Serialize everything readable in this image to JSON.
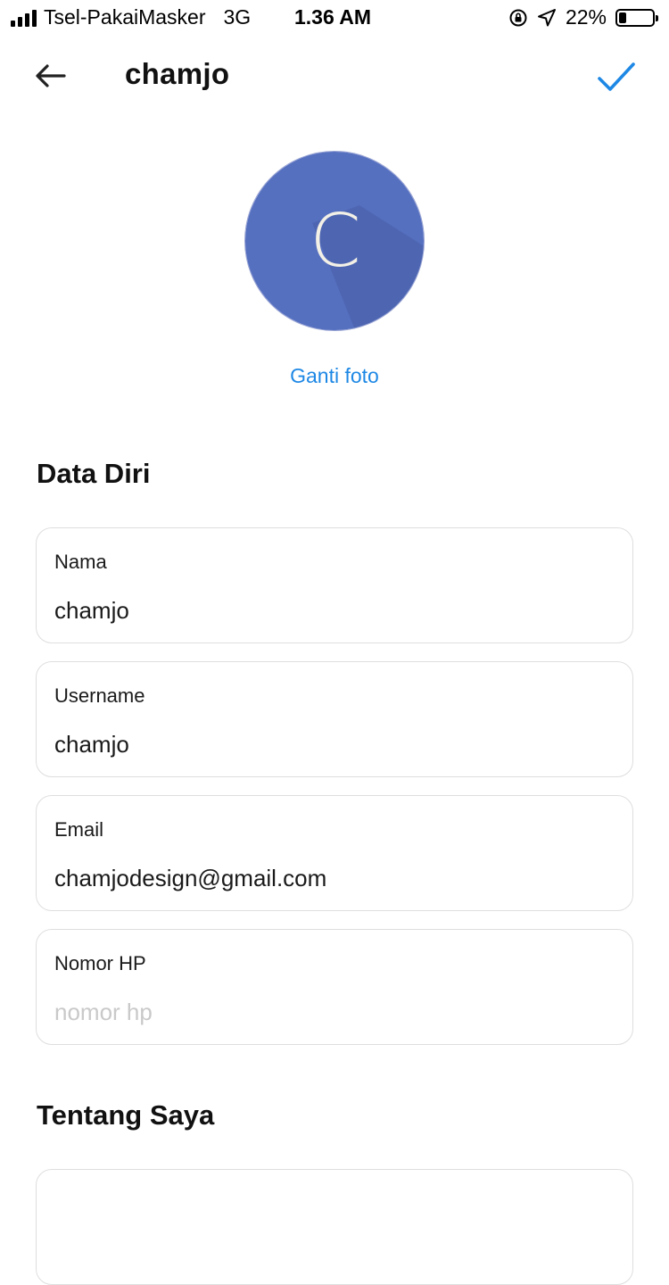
{
  "status_bar": {
    "carrier": "Tsel-PakaiMasker",
    "network": "3G",
    "time": "1.36 AM",
    "battery_percent": "22%",
    "battery_level": 0.22
  },
  "header": {
    "title": "chamjo",
    "accent_color": "#1e88e5"
  },
  "avatar": {
    "letter": "C",
    "bg_color": "#5670c0",
    "change_photo_label": "Ganti foto"
  },
  "sections": {
    "personal_title": "Data Diri",
    "about_title": "Tentang Saya"
  },
  "fields": [
    {
      "label": "Nama",
      "value": "chamjo"
    },
    {
      "label": "Username",
      "value": "chamjo"
    },
    {
      "label": "Email",
      "value": "chamjodesign@gmail.com"
    },
    {
      "label": "Nomor HP",
      "value": "",
      "placeholder": "nomor hp"
    }
  ]
}
